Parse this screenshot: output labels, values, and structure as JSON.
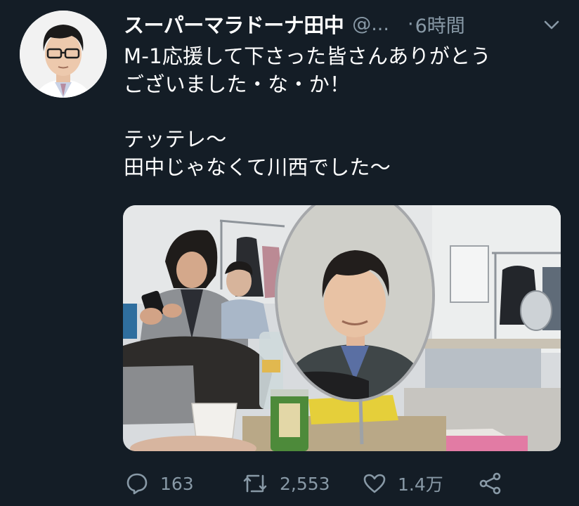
{
  "tweet": {
    "display_name": "スーパーマラドーナ田中",
    "handle": "@...",
    "separator": "·",
    "timestamp": "6時間",
    "text_lines": [
      "M-1応援して下さった皆さんありがとう",
      "ございました・な・か！",
      "",
      "テッテレ〜",
      "田中じゃなくて川西でした〜"
    ],
    "media_alt": "photo",
    "icons": {
      "menu": "chevron-down-icon",
      "reply": "reply-icon",
      "retweet": "retweet-icon",
      "like": "heart-icon",
      "share": "share-icon"
    },
    "actions": {
      "reply_count": "163",
      "retweet_count": "2,553",
      "like_count": "1.4万"
    }
  },
  "colors": {
    "background": "#141d26",
    "primary_text": "#ffffff",
    "secondary_text": "#8899a6"
  }
}
